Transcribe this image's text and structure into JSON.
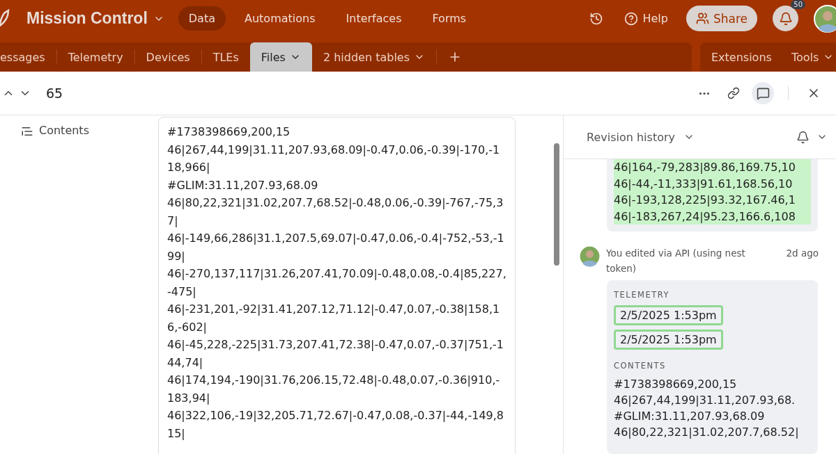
{
  "app": {
    "title": "Mission Control"
  },
  "nav": [
    {
      "label": "Data",
      "selected": true
    },
    {
      "label": "Automations",
      "selected": false
    },
    {
      "label": "Interfaces",
      "selected": false
    },
    {
      "label": "Forms",
      "selected": false
    }
  ],
  "header_actions": {
    "help": "Help",
    "share": "Share",
    "notifications_badge": "50"
  },
  "tables": [
    {
      "label": "essages",
      "selected": false,
      "dropdown": false
    },
    {
      "label": "Telemetry",
      "selected": false,
      "dropdown": false
    },
    {
      "label": "Devices",
      "selected": false,
      "dropdown": false
    },
    {
      "label": "TLEs",
      "selected": false,
      "dropdown": false
    },
    {
      "label": "Files",
      "selected": true,
      "dropdown": true
    },
    {
      "label": "2 hidden tables",
      "selected": false,
      "dropdown": true
    }
  ],
  "table_tools": [
    {
      "label": "Extensions",
      "dropdown": false
    },
    {
      "label": "Tools",
      "dropdown": true
    }
  ],
  "record": {
    "title": "65",
    "comments_open": true
  },
  "field": {
    "label": "Contents",
    "lines": [
      "#1738398669,200,15",
      "46|267,44,199|31.11,207.93,68.09|-0.47,0.06,-0.39|-170,-118,966|",
      "#GLIM:31.11,207.93,68.09",
      "46|80,22,321|31.02,207.7,68.52|-0.48,0.06,-0.39|-767,-75,37|",
      "46|-149,66,286|31.1,207.5,69.07|-0.47,0.06,-0.4|-752,-53,-199|",
      "46|-270,137,117|31.26,207.41,70.09|-0.48,0.08,-0.4|85,227,-475|",
      "46|-231,201,-92|31.41,207.12,71.12|-0.47,0.07,-0.38|158,16,-602|",
      "46|-45,228,-225|31.73,207.41,72.38|-0.47,0.07,-0.37|751,-144,74|",
      "46|174,194,-190|31.76,206.15,72.48|-0.48,0.07,-0.36|910,-183,94|",
      "46|322,106,-19|32,205.71,72.67|-0.47,0.08,-0.37|-44,-149,815|"
    ]
  },
  "history": {
    "title": "Revision history",
    "added_lines": [
      "46|164,-79,283|89.86,169.75,10",
      "46|-44,-11,333|91.61,168.56,10",
      "46|-193,128,225|93.32,167.46,1",
      "46|-183,267,24|95.23,166.6,108"
    ],
    "entry": {
      "text": "You edited via API (using nest token)",
      "time": "2d ago",
      "sections": [
        {
          "kind": "pills",
          "label": "TELEMETRY",
          "items": [
            "2/5/2025 1:53pm",
            "2/5/2025 1:53pm"
          ]
        },
        {
          "kind": "text",
          "label": "CONTENTS",
          "items": [
            "#1738398669,200,15",
            "46|267,44,199|31.11,207.93,68.",
            "#GLIM:31.11,207.93,68.09",
            "46|80,22,321|31.02,207.7,68.52|"
          ]
        }
      ]
    }
  }
}
